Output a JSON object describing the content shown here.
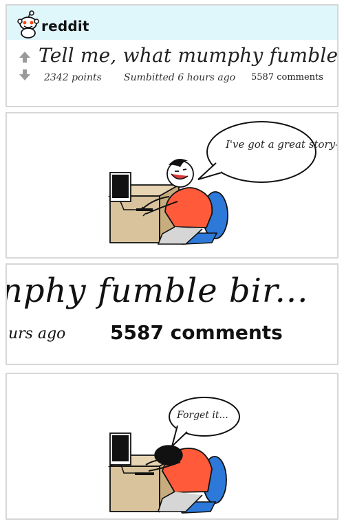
{
  "post": {
    "brand": "reddit",
    "title": "Tell me, what mumphy fumble bir...",
    "points": "2342 points",
    "submitted": "Sumbitted 6 hours ago",
    "comments": "5587 comments"
  },
  "panel_2": {
    "speech": "I've got a great story—"
  },
  "panel_3": {
    "title_zoom": "nphy fumble bir...",
    "submitted_zoom": "urs ago",
    "comments_zoom": "5587 comments"
  },
  "panel_4": {
    "speech": "Forget it..."
  },
  "colors": {
    "header_bg": "#dff6fb",
    "panel_border": "#d7d7d7",
    "shirt": "#ff5b3a",
    "chair": "#2d79d9",
    "desk": "#d9c39d",
    "text": "#222222"
  }
}
